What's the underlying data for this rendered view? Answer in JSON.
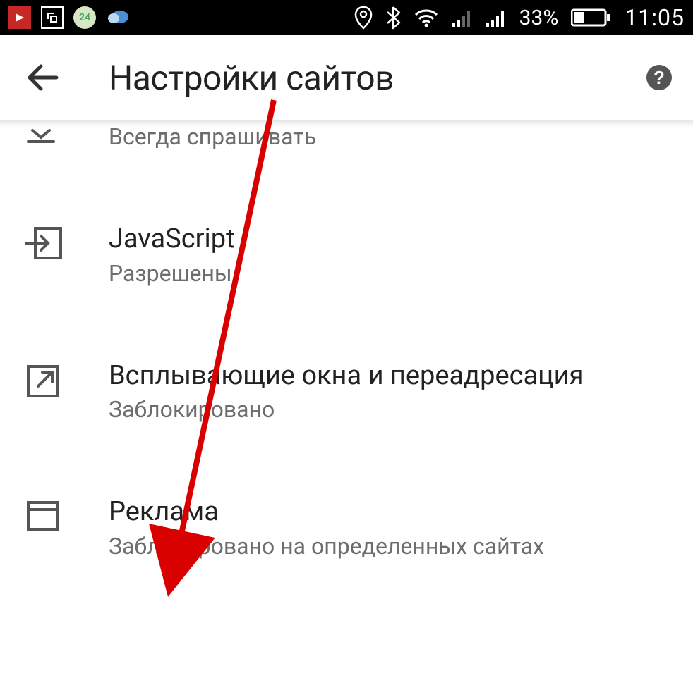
{
  "statusbar": {
    "notifications": [
      {
        "name": "app1-icon"
      },
      {
        "name": "app2-icon"
      },
      {
        "name": "app3-icon"
      },
      {
        "name": "app4-icon"
      }
    ],
    "battery_pct": "33%",
    "clock": "11:05"
  },
  "header": {
    "title": "Настройки сайтов"
  },
  "items": [
    {
      "icon": "download-icon",
      "title": "",
      "subtitle": "Всегда спрашивать"
    },
    {
      "icon": "enter-icon",
      "title": "JavaScript",
      "subtitle": "Разрешены"
    },
    {
      "icon": "open-external-icon",
      "title": "Всплывающие окна и переадресация",
      "subtitle": "Заблокировано"
    },
    {
      "icon": "browser-window-icon",
      "title": "Реклама",
      "subtitle": "Заблокировано на определенных сайтах"
    }
  ],
  "annotation": {
    "arrow": {
      "from": "header-title",
      "to": "item-ads",
      "color": "#d90000"
    }
  }
}
